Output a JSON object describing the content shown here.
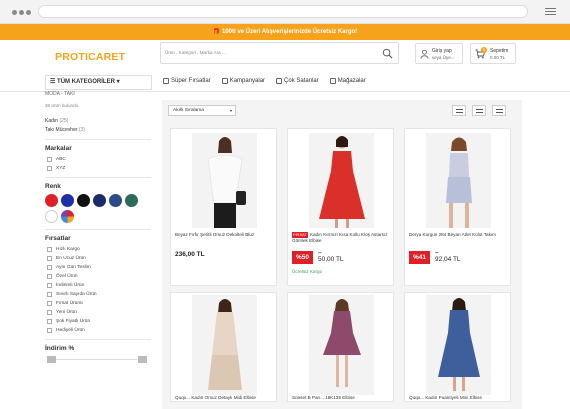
{
  "colors": {
    "accent": "#f7a21b",
    "discount": "#e01f26",
    "free_shipping": "#3aa14a"
  },
  "promo": "100tl ve Üzeri Alışverişlerinizde Ücretsiz Kargo!",
  "logo": "PROTICARET",
  "search": {
    "placeholder": "Ürün , Kategori , Marka Ara ..."
  },
  "account": {
    "line1": "Giriş yap",
    "line2": "veya Üye..."
  },
  "cart": {
    "line1": "Sepetim",
    "line2": "0.00 TL",
    "count": "0"
  },
  "nav": {
    "categories_label": "TÜM KATEGORİLER",
    "links": [
      {
        "label": "Süper Fırsatlar",
        "icon": "tag-icon"
      },
      {
        "label": "Kampanyalar",
        "icon": "megaphone-icon"
      },
      {
        "label": "Çok Satanlar",
        "icon": "trend-icon"
      },
      {
        "label": "Mağazalar",
        "icon": "store-icon"
      }
    ]
  },
  "sidebar": {
    "breadcrumb": "MODA - TAKI",
    "result_count": "36 ürün bulundu.",
    "categories": [
      {
        "name": "Kadın",
        "count": "(25)"
      },
      {
        "name": "Takı Mücevher",
        "count": "(3)"
      }
    ],
    "brands_title": "Markalar",
    "brands": [
      "ABC",
      "XYZ"
    ],
    "color_title": "Renk",
    "swatches": [
      "#e01f26",
      "#1f2fa8",
      "#111111",
      "#1a2b6b",
      "#2c4a86",
      "#2e6a5a",
      "#ffffff",
      "multicolor"
    ],
    "opps_title": "Fırsatlar",
    "opps": [
      "Hızlı Kargo",
      "En Ucuz Ürün",
      "Aynı Gün Teslim",
      "Özel Ürün",
      "İndirimli Ürün",
      "Sınırlı Sayıda Ürün",
      "Fırsat Ürünü",
      "Yeni Ürün",
      "Şok Fiyatlı Ürün",
      "Hediyeli Ürün"
    ],
    "discount_title": "İndirim %",
    "slider": {
      "min": "0",
      "max": "100"
    }
  },
  "toolbar": {
    "sort": "Akıllı Sıralama"
  },
  "products": [
    {
      "title": "Beyaz Fırfır Şeritli Omuz Dekolteli Bluz",
      "price": "236,00 TL"
    },
    {
      "badge": "FIRSAT",
      "title": "Kadın Kırmızı Kısa Kollu Kloş Astarsız Gömlek Elbise",
      "discount": "%50",
      "old_price": "...",
      "new_price": "50,00 TL",
      "shipping": "Ücretsiz Kargo"
    },
    {
      "title": "Derya Kurgun 284 Beyan Atlet Kolot Takım",
      "discount": "%41",
      "old_price": "...",
      "new_price": "92,04 TL"
    },
    {
      "title": "Ququ... Kadın Omuz Detaylı Midi Elbise"
    },
    {
      "title": "Sonset B Pan... 18K135 Elbise"
    },
    {
      "title": "Ququ... Kadın Puantiyeli Mini Elbise"
    }
  ]
}
